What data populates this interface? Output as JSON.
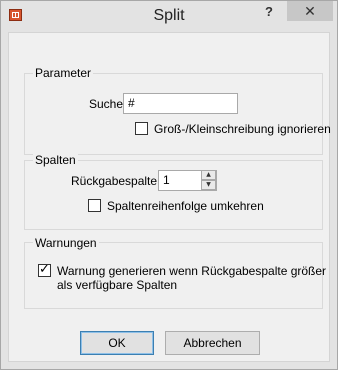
{
  "window": {
    "title": "Split",
    "help_label": "?",
    "close_label": "✕"
  },
  "parameter": {
    "group_label": "Parameter",
    "search_label": "Suche",
    "search_value": "#",
    "case_label": "Groß-/Kleinschreibung ignorieren",
    "case_checked": false
  },
  "columns": {
    "group_label": "Spalten",
    "return_label": "Rückgabespalte",
    "return_value": "1",
    "reverse_label": "Spaltenreihenfolge umkehren",
    "reverse_checked": false
  },
  "warnings": {
    "group_label": "Warnungen",
    "warn_line1": "Warnung generieren wenn Rückgabespalte größer",
    "warn_line2": "als verfügbare Spalten",
    "warn_checked": true
  },
  "buttons": {
    "ok_label": "OK",
    "cancel_label": "Abbrechen"
  }
}
